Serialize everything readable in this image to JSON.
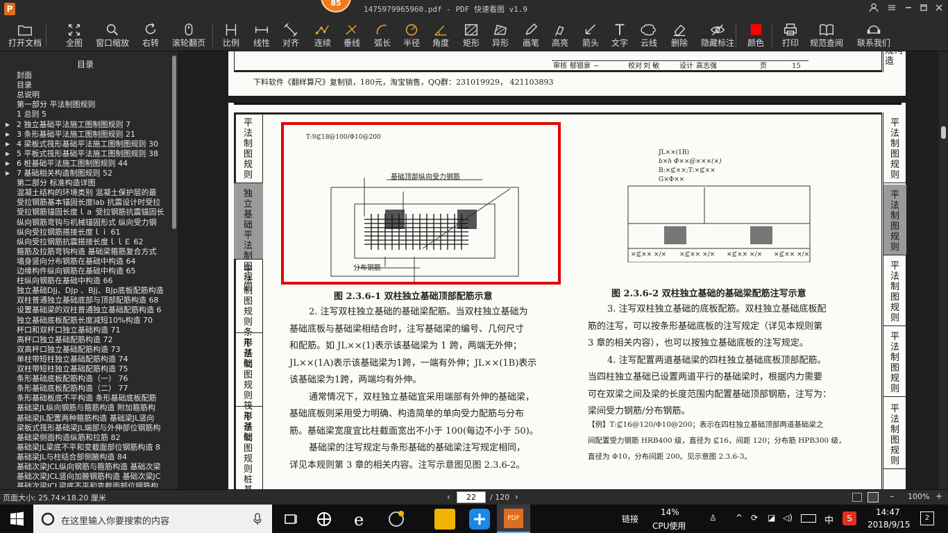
{
  "titlebar": {
    "logo": "P",
    "badge": "85",
    "title": "1475979965960.pdf - PDF 快速看图 v1.9"
  },
  "toolbar": {
    "tools": [
      {
        "label": "打开文档",
        "icon": "folder-icon"
      },
      {
        "label": "全图",
        "icon": "fit-page-icon"
      },
      {
        "label": "窗口缩放",
        "icon": "zoom-icon"
      },
      {
        "label": "右转",
        "icon": "rotate-right-icon"
      },
      {
        "label": "滚轮翻页",
        "icon": "mouse-wheel-icon"
      },
      {
        "label": "比例",
        "icon": "scale-icon"
      },
      {
        "label": "线性",
        "icon": "linear-measure-icon"
      },
      {
        "label": "对齐",
        "icon": "align-measure-icon"
      },
      {
        "label": "连续",
        "icon": "continuous-measure-icon"
      },
      {
        "label": "垂线",
        "icon": "perpendicular-icon"
      },
      {
        "label": "弧长",
        "icon": "arc-length-icon"
      },
      {
        "label": "半径",
        "icon": "radius-icon"
      },
      {
        "label": "角度",
        "icon": "angle-icon"
      },
      {
        "label": "矩形",
        "icon": "rectangle-area-icon"
      },
      {
        "label": "异形",
        "icon": "polygon-area-icon"
      },
      {
        "label": "画笔",
        "icon": "pen-icon"
      },
      {
        "label": "高亮",
        "icon": "highlighter-icon"
      },
      {
        "label": "箭头",
        "icon": "arrow-icon"
      },
      {
        "label": "文字",
        "icon": "text-icon"
      },
      {
        "label": "云线",
        "icon": "cloud-line-icon"
      },
      {
        "label": "删除",
        "icon": "eraser-icon"
      },
      {
        "label": "隐藏标注",
        "icon": "hide-annotation-icon"
      },
      {
        "label": "颜色",
        "icon": "color-swatch-icon"
      },
      {
        "label": "打印",
        "icon": "printer-icon"
      },
      {
        "label": "规范查阅",
        "icon": "book-icon"
      },
      {
        "label": "联系我们",
        "icon": "contact-icon"
      }
    ],
    "color_swatch": "#ff0000"
  },
  "sidebar": {
    "title": "目录",
    "items": [
      {
        "text": "封面",
        "expand": false,
        "indent": 1
      },
      {
        "text": "目录",
        "expand": false,
        "indent": 1
      },
      {
        "text": "总说明",
        "expand": false,
        "indent": 1
      },
      {
        "text": "第一部分  平法制图规则",
        "expand": false,
        "indent": 1
      },
      {
        "text": "1  总则  5",
        "expand": false,
        "indent": 1
      },
      {
        "text": "2  独立基础平法施工图制图规则  7",
        "expand": true,
        "indent": 1
      },
      {
        "text": "3  条形基础平法施工图制图规则  21",
        "expand": true,
        "indent": 1
      },
      {
        "text": "4  梁板式筏形基础平法施工图制图规则  30",
        "expand": true,
        "indent": 1
      },
      {
        "text": "5  平板式筏形基础平法施工图制图规则  38",
        "expand": true,
        "indent": 1
      },
      {
        "text": "6  桩基础平法施工图制图规则  44",
        "expand": true,
        "indent": 1
      },
      {
        "text": "7  基础相关构造制图规则  52",
        "expand": true,
        "indent": 1
      },
      {
        "text": "第二部分  标准构造详图",
        "expand": false,
        "indent": 1
      },
      {
        "text": "混凝土结构的环境类别  混凝土保护层的最",
        "expand": false,
        "indent": 1
      },
      {
        "text": "受拉钢筋基本锚固长度lab  抗震设计时受拉",
        "expand": false,
        "indent": 1
      },
      {
        "text": "受拉钢筋锚固长度ｌａ 受拉钢筋抗震锚固长",
        "expand": false,
        "indent": 1
      },
      {
        "text": "纵向钢筋弯钩与机械锚固形式  纵向受力钢",
        "expand": false,
        "indent": 1
      },
      {
        "text": "纵向受拉钢筋搭接长度ｌｉ  61",
        "expand": false,
        "indent": 1
      },
      {
        "text": "纵向受拉钢筋抗震搭接长度ｌｌＥ  62",
        "expand": false,
        "indent": 1
      },
      {
        "text": "箍筋及拉筋弯钩构造  基础梁箍筋复合方式",
        "expand": false,
        "indent": 1
      },
      {
        "text": "墙身竖向分布钢筋在基础中构造  64",
        "expand": false,
        "indent": 1
      },
      {
        "text": "边缘构件纵向钢筋在基础中构造  65",
        "expand": false,
        "indent": 1
      },
      {
        "text": "柱纵向钢筋在基础中构造  66",
        "expand": false,
        "indent": 1
      },
      {
        "text": "独立基础DJj、DJp  、BJj、BJp底板配筋构造",
        "expand": false,
        "indent": 1
      },
      {
        "text": "双柱普通独立基础底部与顶部配筋构造  68",
        "expand": false,
        "indent": 1
      },
      {
        "text": "设置基础梁的双柱普通独立基础配筋构造  6",
        "expand": false,
        "indent": 1
      },
      {
        "text": "独立基础底板配筋长度减短10%构造  70",
        "expand": false,
        "indent": 1
      },
      {
        "text": "杯口和双杯口独立基础构造  71",
        "expand": false,
        "indent": 1
      },
      {
        "text": "高杯口独立基础配筋构造  72",
        "expand": false,
        "indent": 1
      },
      {
        "text": "双高杯口独立基础配筋构造  73",
        "expand": false,
        "indent": 1
      },
      {
        "text": "单柱带短柱独立基础配筋构造  74",
        "expand": false,
        "indent": 1
      },
      {
        "text": "双柱带短柱独立基础配筋构造  75",
        "expand": false,
        "indent": 1
      },
      {
        "text": "条形基础底板配筋构造（一）  76",
        "expand": false,
        "indent": 1
      },
      {
        "text": "条形基础底板配筋构造（二）  77",
        "expand": false,
        "indent": 1
      },
      {
        "text": "条形基础板底不平构造  条形基础底板配筋",
        "expand": false,
        "indent": 1
      },
      {
        "text": "基础梁JL纵向钢筋与箍筋构造  附加箍筋构",
        "expand": false,
        "indent": 1
      },
      {
        "text": "基础梁JL配置两种箍筋构造  基础梁JL竖向",
        "expand": false,
        "indent": 1
      },
      {
        "text": "梁板式筏形基础梁JL端部与外伸部位钢筋构",
        "expand": false,
        "indent": 1
      },
      {
        "text": "基础梁侧面构造纵筋和拉筋  82",
        "expand": false,
        "indent": 1
      },
      {
        "text": "基础梁JL梁底不平和变截面部位钢筋构造  8",
        "expand": false,
        "indent": 1
      },
      {
        "text": "基础梁JL与柱结合部侧腋构造  84",
        "expand": false,
        "indent": 1
      },
      {
        "text": "基础次梁JCL纵向钢筋与箍筋构造  基础次梁",
        "expand": false,
        "indent": 1
      },
      {
        "text": "基础次梁JCL竖向加腋钢筋构造  基础次梁JC",
        "expand": false,
        "indent": 1
      },
      {
        "text": "基础次梁JCL梁底不平和变截面部位钢筋构",
        "expand": false,
        "indent": 1
      }
    ]
  },
  "document": {
    "top_page": {
      "sig_row": {
        "c1": "审核",
        "c2": "郁银泉",
        "c3": "",
        "c4": "校对",
        "c5": "刘  敏",
        "c6": "",
        "c7": "设计",
        "c8": "高志强",
        "c9": "",
        "c10": "页",
        "c11": "15"
      },
      "footer_note": "下料软件《翻样算尺》复制锁，180元，淘宝销售，QQ群：231019929， 421103893",
      "right_tab_text": "规构造"
    },
    "left_tabs": [
      {
        "text": "平法制图规则",
        "active": false
      },
      {
        "text": "独立基础平法制图规则",
        "active": true
      },
      {
        "text": "平法制图规则条形基础",
        "active": false
      },
      {
        "text": "平法制图规则筏形基础",
        "active": false
      },
      {
        "text": "平法制图规则桩基础",
        "active": false
      }
    ],
    "right_tabs": [
      {
        "text": "平法制图规则",
        "active": false
      },
      {
        "text": "平法制图规则",
        "active": true
      },
      {
        "text": "平法制图规则",
        "active": false
      },
      {
        "text": "平法制图规则",
        "active": false
      },
      {
        "text": "平法制图规则",
        "active": false
      }
    ],
    "fig1": {
      "label_top": "T:9⊈18@100/Φ10@200",
      "label_rebar": "基础顶部纵向受力钢筋",
      "label_dist": "分布钢筋",
      "caption": "图 2.3.6-1  双柱独立基础顶部配筋示意",
      "highlight_color": "#e00000"
    },
    "fig2": {
      "l1": "JL××(1B)",
      "l2": "b×h  Φ××@×××(×)",
      "l3": "B:×⊈××;T:×⊈××",
      "l4": "G×Φ××",
      "bottom": [
        "×⊈××  ×/×",
        "×⊈××  ×/×",
        "×⊈××  ×/×",
        "×⊈××  ×/×"
      ],
      "caption": "图 2.3.6-2  双柱独立基础的基础梁配筋注写示意"
    },
    "left_paragraphs": [
      "2. 注写双柱独立基础的基础梁配筋。当双柱独立基础为",
      "基础底板与基础梁相结合时，注写基础梁的编号、几何尺寸",
      "和配筋。如  JL××(1)表示该基础梁为 1 跨，两端无外伸；",
      "JL××(1A)表示该基础梁为1跨，一端有外伸；JL××(1B)表示",
      "该基础梁为1跨，两端均有外伸。",
      "通常情况下，双柱独立基础宜采用端部有外伸的基础梁，",
      "基础底板则采用受力明确、构造简单的单向受力配筋与分布",
      "筋。基础梁宽度宜比柱截面宽出不小于 100(每边不小于 50)。",
      "基础梁的注写规定与条形基础的基础梁注写规定相同，",
      "详见本规则第 3 章的相关内容。注写示意图见图 2.3.6-2。"
    ],
    "right_paragraphs": [
      "3. 注写双柱独立基础的底板配筋。双柱独立基础底板配",
      "筋的注写，可以按条形基础底板的注写规定（详见本规则第",
      "3 章的相关内容），也可以按独立基础底板的注写规定。",
      "4. 注写配置两道基础梁的四柱独立基础底板顶部配筋。",
      "当四柱独立基础已设置两道平行的基础梁时，根据内力需要",
      "可在双梁之间及梁的长度范围内配置基础顶部钢筋，注写为：",
      "梁间受力钢筋/分布钢筋。"
    ],
    "example": [
      "【例】T:⊈16@120/Φ10@200；表示在四柱独立基础顶部两道基础梁之",
      "间配置受力钢筋 HRB400 级，直径为 ⊈16，间距 120；分布筋 HPB300 级，",
      "直径为 Φ10，分布间距 200。见示意图 2.3.6-3。"
    ]
  },
  "statusbar": {
    "page_size": "页面大小: 25.74×18.20 厘米",
    "current_page": "22",
    "total_pages": "/ 120",
    "zoom": "100%"
  },
  "taskbar": {
    "search_placeholder": "在这里输入你要搜索的内容",
    "link_label": "链接",
    "cpu_value": "14%",
    "cpu_label": "CPU使用",
    "ime": "中",
    "time": "14:47",
    "date": "2018/9/15",
    "notif_count": "2"
  }
}
